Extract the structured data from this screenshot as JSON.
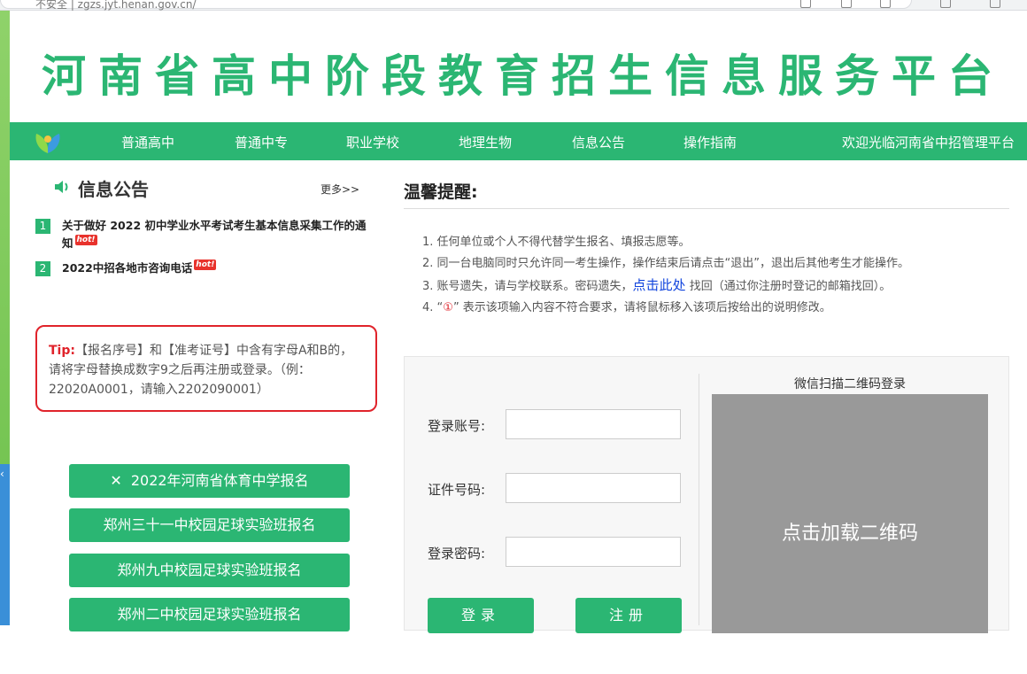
{
  "browser": {
    "url_text": "不安全 | zgzs.jyt.henan.gov.cn/",
    "reader_icon": "reader-icon",
    "extensions_icon": "extensions-icon",
    "profile_icon": "profile-icon"
  },
  "site": {
    "title": "河南省高中阶段教育招生信息服务平台",
    "brand_color": "#2bb673"
  },
  "nav": {
    "items": [
      "普通高中",
      "普通中专",
      "职业学校",
      "地理生物",
      "信息公告",
      "操作指南"
    ],
    "welcome": "欢迎光临河南省中招管理平台"
  },
  "notice": {
    "title": "信息公告",
    "more": "更多>>",
    "items": [
      {
        "num": "1",
        "text": "关于做好 2022 初中学业水平考试考生基本信息采集工作的通知",
        "hot": "hot!"
      },
      {
        "num": "2",
        "text": "2022中招各地市咨询电话",
        "hot": "hot!"
      }
    ]
  },
  "tip": {
    "label": "Tip:",
    "text": "【报名序号】和【准考证号】中含有字母A和B的，请将字母替换成数字9之后再注册或登录。（例：22020A0001，请输入2202090001）"
  },
  "side_buttons": [
    "2022年河南省体育中学报名",
    "郑州三十一中校园足球实验班报名",
    "郑州九中校园足球实验班报名",
    "郑州二中校园足球实验班报名"
  ],
  "reminder": {
    "title": "温馨提醒:",
    "line1": "1. 任何单位或个人不得代替学生报名、填报志愿等。",
    "line2": "2. 同一台电脑同时只允许同一考生操作，操作结束后请点击“退出”，退出后其他考生才能操作。",
    "line3_a": "3. 账号遗失，请与学校联系。密码遗失，",
    "line3_link": "点击此处",
    "line3_b": " 找回（通过你注册时登记的邮箱找回）。",
    "line4_a": "4. “",
    "line4_icon": "①",
    "line4_b": "” 表示该项输入内容不符合要求，请将鼠标移入该项后按给出的说明修改。"
  },
  "login": {
    "account_label": "登录账号:",
    "account_value": "",
    "id_label": "证件号码:",
    "id_value": "",
    "password_label": "登录密码:",
    "password_value": "",
    "login_button": "登录",
    "register_button": "注册"
  },
  "qr": {
    "title": "微信扫描二维码登录",
    "placeholder": "点击加载二维码"
  }
}
